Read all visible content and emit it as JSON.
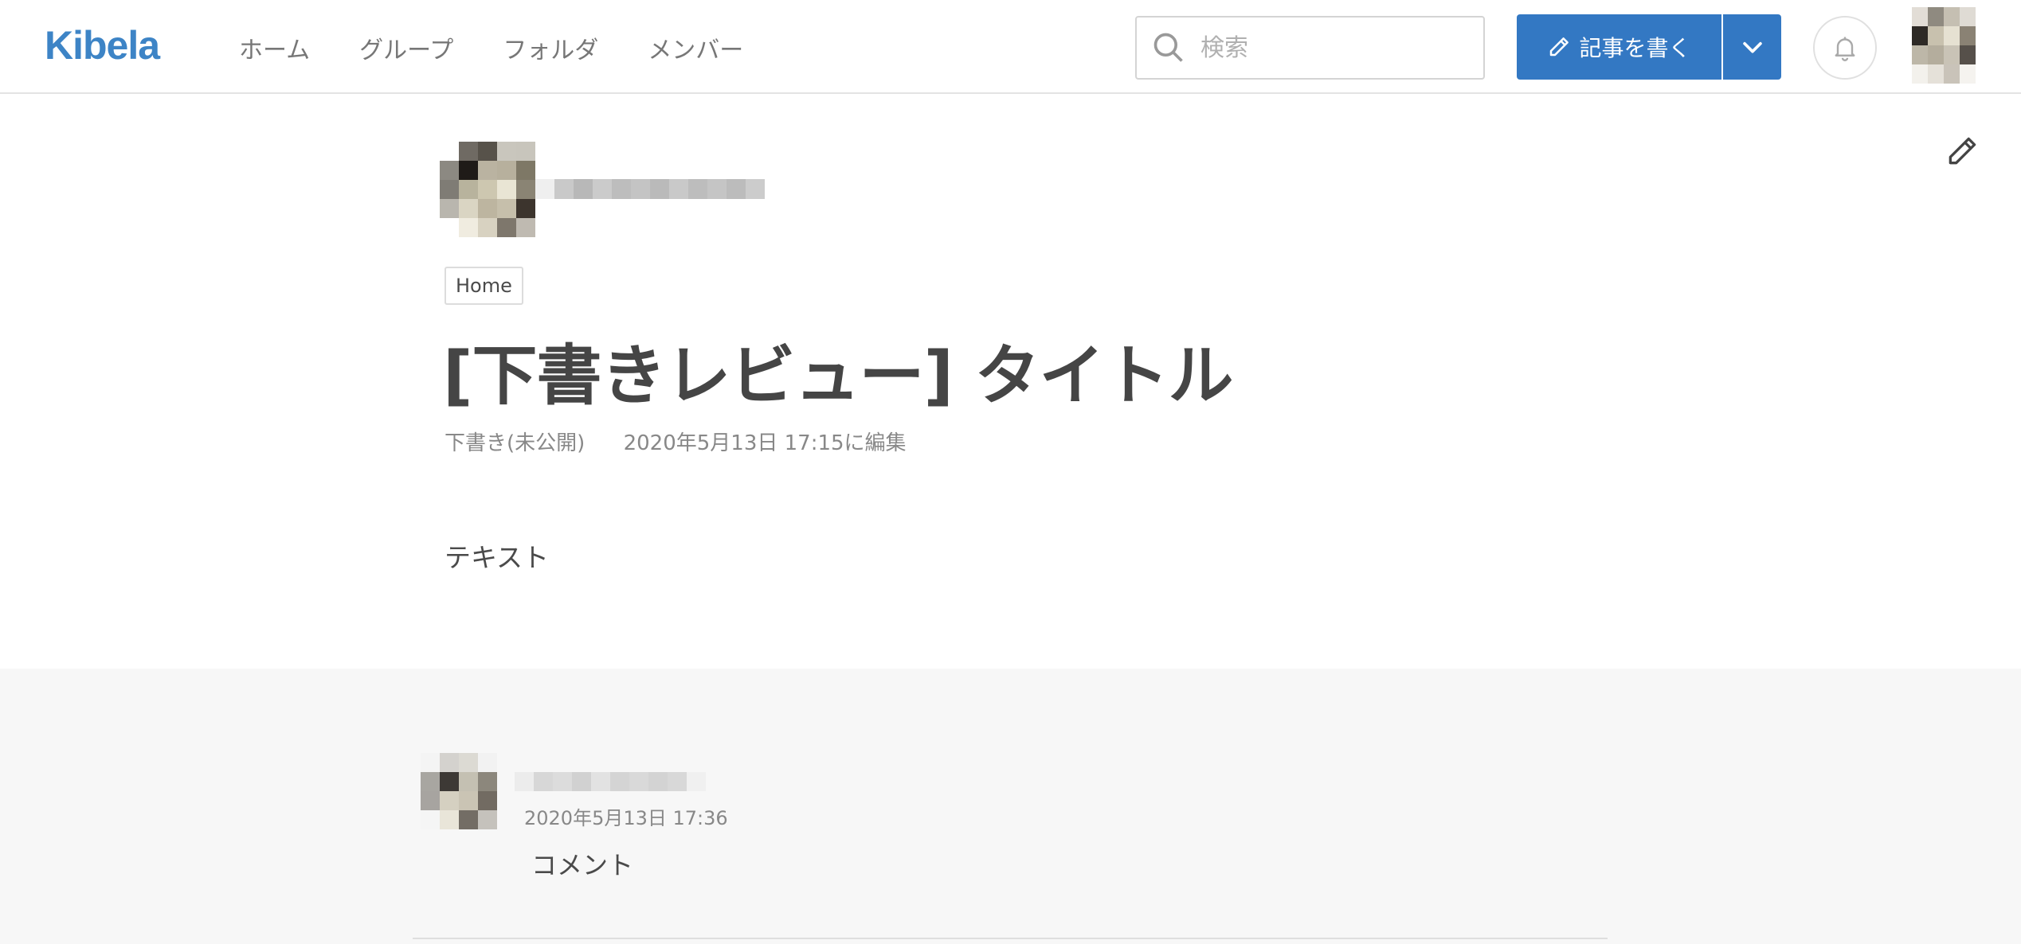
{
  "app": {
    "logo": "Kibela"
  },
  "nav": {
    "items": [
      {
        "label": "ホーム"
      },
      {
        "label": "グループ"
      },
      {
        "label": "フォルダ"
      },
      {
        "label": "メンバー"
      }
    ]
  },
  "search": {
    "placeholder": "検索",
    "icon": "search-icon"
  },
  "toolbar": {
    "write_label": "記事を書く",
    "write_icon": "pencil-icon",
    "dropdown_icon": "chevron-down-icon",
    "notification_icon": "bell-icon"
  },
  "article": {
    "folder_tag": "Home",
    "title": "[下書きレビュー] タイトル",
    "status": "下書き(未公開)",
    "edited": "2020年5月13日 17:15に編集",
    "body": "テキスト",
    "edit_icon": "pencil-icon"
  },
  "comments": [
    {
      "date": "2020年5月13日 17:36",
      "text": "コメント"
    }
  ],
  "colors": {
    "brand": "#3d84c6",
    "primary_button": "#3378c3",
    "comment_background": "#f7f7f7",
    "muted_text": "#888888"
  }
}
